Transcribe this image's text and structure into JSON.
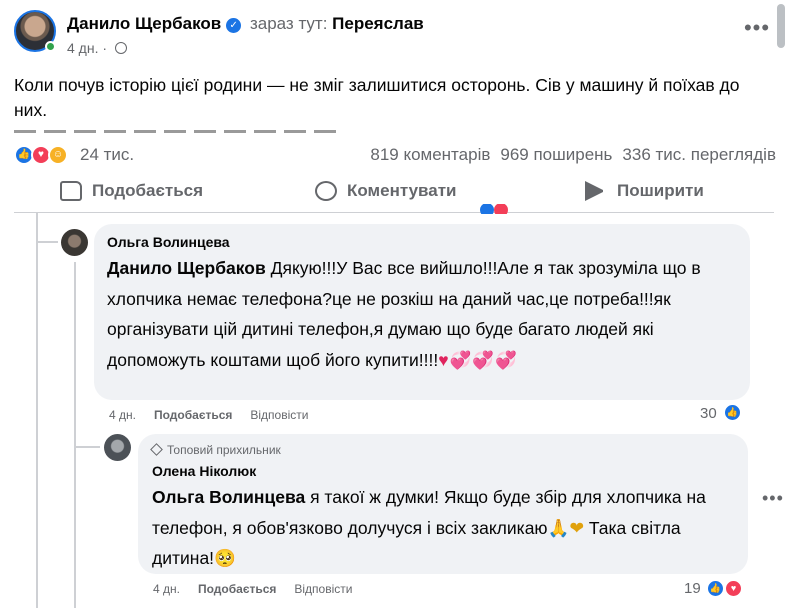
{
  "post": {
    "author": "Данило Щербаков",
    "location_prefix": "зараз тут:",
    "location": "Переяслав",
    "time": "4 дн.",
    "text": "Коли почув історію цієї родини — не зміг залишитися осторонь. Сів у машину й поїхав до них.",
    "more_icon": "more-horizontal-icon",
    "privacy_icon": "globe-icon"
  },
  "stats": {
    "reactions_count": "24 тис.",
    "reaction_icons": [
      "like-icon",
      "love-icon",
      "care-icon"
    ],
    "comments": "819 коментарів",
    "shares": "969 поширень",
    "views": "336 тис. переглядів"
  },
  "actions": {
    "like": "Подобається",
    "comment": "Коментувати",
    "share": "Поширити"
  },
  "comments": [
    {
      "author": "Ольга Волинцева",
      "mention": "Данило Щербаков",
      "text": " Дякую!!!У Вас все вийшло!!!Але я так зрозуміла що в хлопчика немає телефона?це не розкіш на даний час,це потреба!!!як організувати цій дитині телефон,я думаю що буде багато людей які допоможуть коштами щоб його купити!!!!",
      "emojis": "♥💞💞💞",
      "time": "4 дн.",
      "like_label": "Подобається",
      "reply_label": "Відповісти",
      "reactions_count": "30"
    },
    {
      "badge": "Топовий прихильник",
      "author": "Олена Ніколюк",
      "mention": "Ольга Волинцева",
      "text": " я такої ж думки! Якщо буде збір для хлопчика на телефон, я обов'язково долучуся і всіх закликаю",
      "emoji_mid": "🙏❤",
      "text_end": " Така світла дитина!",
      "emoji_end": "🥺",
      "time": "4 дн.",
      "like_label": "Подобається",
      "reply_label": "Відповісти",
      "reactions_count": "19"
    }
  ],
  "colors": {
    "accent": "#1b74e4",
    "love": "#f33e58",
    "secondary_text": "#65676b",
    "bubble": "#f0f2f5"
  }
}
